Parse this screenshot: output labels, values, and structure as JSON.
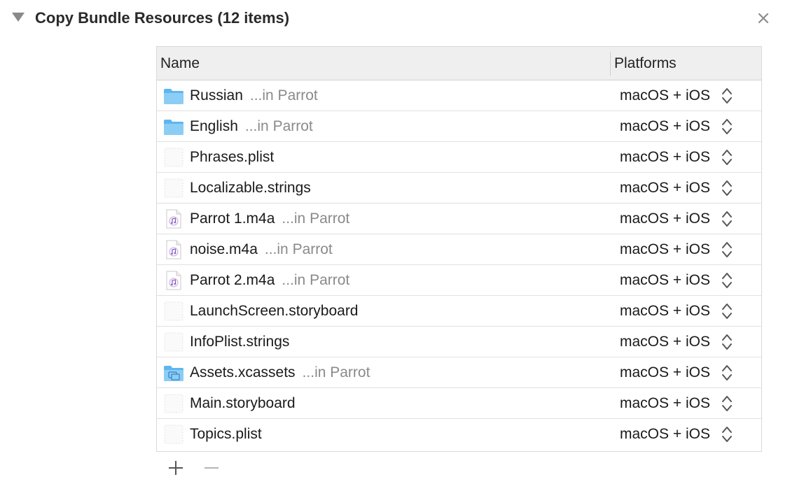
{
  "section": {
    "title": "Copy Bundle Resources (12 items)"
  },
  "table": {
    "columns": {
      "name": "Name",
      "platforms": "Platforms"
    },
    "rows": [
      {
        "name": "Russian",
        "location": "...in Parrot",
        "icon": "folder-icon",
        "platform": "macOS + iOS"
      },
      {
        "name": "English",
        "location": "...in Parrot",
        "icon": "folder-icon",
        "platform": "macOS + iOS"
      },
      {
        "name": "Phrases.plist",
        "location": "",
        "icon": "file-icon",
        "platform": "macOS + iOS"
      },
      {
        "name": "Localizable.strings",
        "location": "",
        "icon": "file-icon",
        "platform": "macOS + iOS"
      },
      {
        "name": "Parrot 1.m4a",
        "location": "...in Parrot",
        "icon": "audio-file-icon",
        "platform": "macOS + iOS"
      },
      {
        "name": "noise.m4a",
        "location": "...in Parrot",
        "icon": "audio-file-icon",
        "platform": "macOS + iOS"
      },
      {
        "name": "Parrot 2.m4a",
        "location": "...in Parrot",
        "icon": "audio-file-icon",
        "platform": "macOS + iOS"
      },
      {
        "name": "LaunchScreen.storyboard",
        "location": "",
        "icon": "file-icon",
        "platform": "macOS + iOS"
      },
      {
        "name": "InfoPlist.strings",
        "location": "",
        "icon": "file-icon",
        "platform": "macOS + iOS"
      },
      {
        "name": "Assets.xcassets",
        "location": "...in Parrot",
        "icon": "asset-catalog-icon",
        "platform": "macOS + iOS"
      },
      {
        "name": "Main.storyboard",
        "location": "",
        "icon": "file-icon",
        "platform": "macOS + iOS"
      },
      {
        "name": "Topics.plist",
        "location": "",
        "icon": "file-icon",
        "platform": "macOS + iOS"
      }
    ]
  },
  "colors": {
    "folder": "#5fb5ee",
    "secondary_text": "#8a8a8a",
    "header_bg": "#efefef"
  }
}
